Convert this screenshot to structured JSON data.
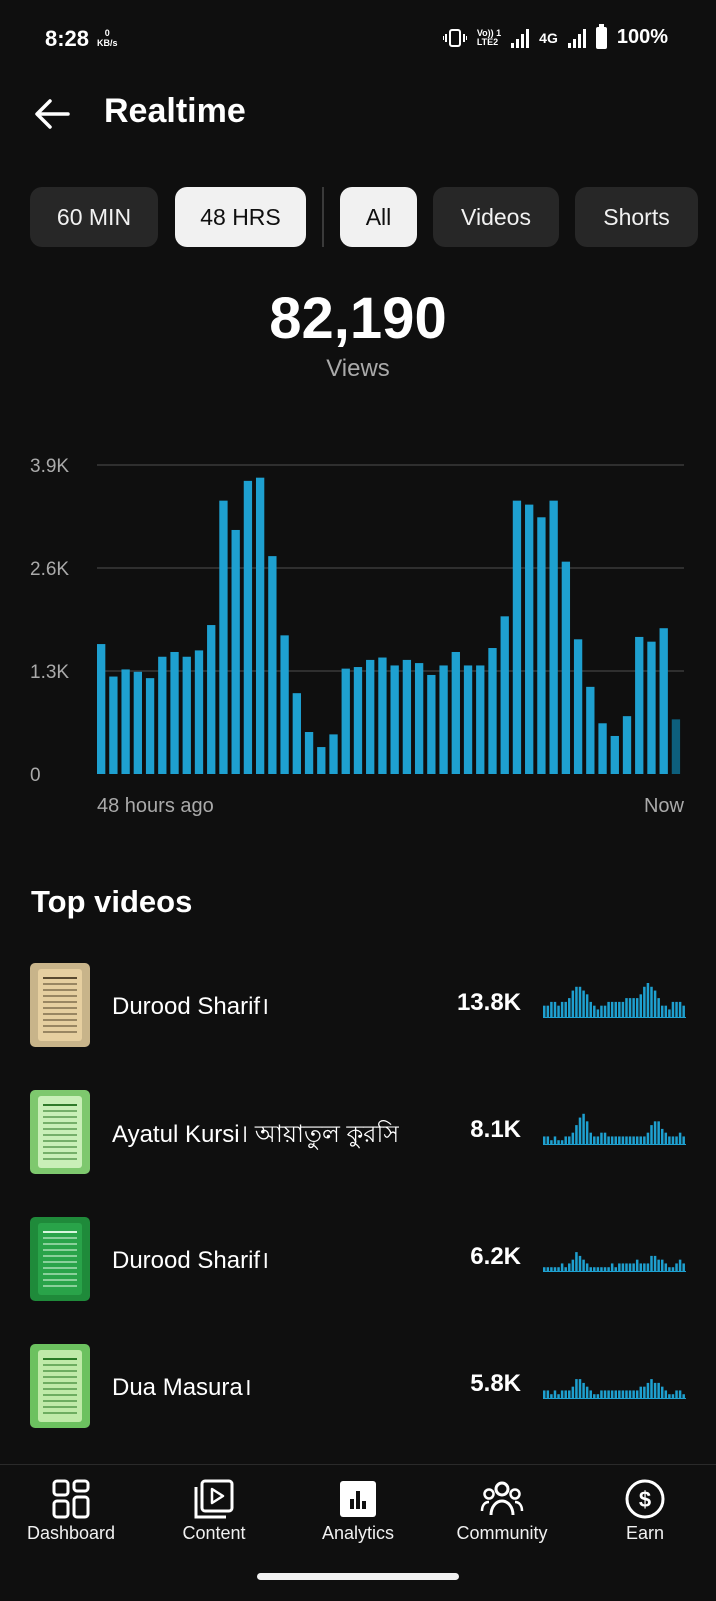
{
  "status": {
    "time": "8:28",
    "speed_value": "0",
    "speed_unit": "KB/s",
    "volte_top": "Vo)) 1",
    "volte_bottom": "LTE2",
    "network": "4G",
    "battery": "100%"
  },
  "header": {
    "title": "Realtime"
  },
  "filters": {
    "time_ranges": [
      {
        "label": "60 MIN",
        "selected": false
      },
      {
        "label": "48 HRS",
        "selected": true
      }
    ],
    "content_types": [
      {
        "label": "All",
        "selected": true
      },
      {
        "label": "Videos",
        "selected": false
      },
      {
        "label": "Shorts",
        "selected": false
      }
    ]
  },
  "summary": {
    "total_views": "82,190",
    "views_label": "Views"
  },
  "chart_data": {
    "type": "bar",
    "title": "",
    "y_ticks": [
      "0",
      "1.3K",
      "2.6K",
      "3.9K"
    ],
    "ylim": [
      0,
      3900
    ],
    "x_start_label": "48 hours ago",
    "x_end_label": "Now",
    "grid": true,
    "bar_color": "#1ea0d0",
    "last_bar_color": "#0d5f7d",
    "values": [
      1640,
      1230,
      1320,
      1290,
      1210,
      1480,
      1540,
      1480,
      1560,
      1880,
      3450,
      3080,
      3700,
      3740,
      2750,
      1750,
      1020,
      530,
      340,
      500,
      1330,
      1350,
      1440,
      1470,
      1370,
      1440,
      1400,
      1250,
      1370,
      1540,
      1370,
      1370,
      1590,
      1990,
      3450,
      3400,
      3240,
      3450,
      2680,
      1700,
      1100,
      640,
      480,
      730,
      1730,
      1670,
      1840,
      690
    ]
  },
  "top_videos": {
    "title": "Top videos",
    "items": [
      {
        "title": "Durood Sharif।",
        "views": "13.8K",
        "thumb_bg": "#c8b48a",
        "thumb_page": "#e6cfa0",
        "thumb_line": "#5a4a30",
        "spark": [
          3,
          3,
          4,
          4,
          3,
          4,
          4,
          5,
          7,
          8,
          8,
          7,
          6,
          4,
          3,
          2,
          3,
          3,
          4,
          4,
          4,
          4,
          4,
          5,
          5,
          5,
          5,
          6,
          8,
          9,
          8,
          7,
          5,
          3,
          3,
          2,
          4,
          4,
          4,
          3
        ]
      },
      {
        "title": "Ayatul Kursi। আয়াতুল কুরসি",
        "views": "8.1K",
        "thumb_bg": "#7ec86e",
        "thumb_page": "#c9efb8",
        "thumb_line": "#2f7a2a",
        "spark": [
          2,
          2,
          1,
          2,
          1,
          1,
          2,
          2,
          3,
          5,
          7,
          8,
          6,
          3,
          2,
          2,
          3,
          3,
          2,
          2,
          2,
          2,
          2,
          2,
          2,
          2,
          2,
          2,
          2,
          3,
          5,
          6,
          6,
          4,
          3,
          2,
          2,
          2,
          3,
          2
        ]
      },
      {
        "title": "Durood Sharif।",
        "views": "6.2K",
        "thumb_bg": "#1f8a3a",
        "thumb_page": "#29a349",
        "thumb_line": "#d8f5dd",
        "spark": [
          1,
          1,
          1,
          1,
          1,
          2,
          1,
          2,
          3,
          5,
          4,
          3,
          2,
          1,
          1,
          1,
          1,
          1,
          1,
          2,
          1,
          2,
          2,
          2,
          2,
          2,
          3,
          2,
          2,
          2,
          4,
          4,
          3,
          3,
          2,
          1,
          1,
          2,
          3,
          2
        ]
      },
      {
        "title": "Dua Masura।",
        "views": "5.8K",
        "thumb_bg": "#6cc15f",
        "thumb_page": "#bfeaa8",
        "thumb_line": "#2a7a25",
        "spark": [
          2,
          2,
          1,
          2,
          1,
          2,
          2,
          2,
          3,
          5,
          5,
          4,
          3,
          2,
          1,
          1,
          2,
          2,
          2,
          2,
          2,
          2,
          2,
          2,
          2,
          2,
          2,
          3,
          3,
          4,
          5,
          4,
          4,
          3,
          2,
          1,
          1,
          2,
          2,
          1
        ]
      }
    ]
  },
  "bottom_nav": [
    {
      "label": "Dashboard",
      "icon": "dashboard-icon"
    },
    {
      "label": "Content",
      "icon": "content-icon"
    },
    {
      "label": "Analytics",
      "icon": "analytics-icon",
      "active": true
    },
    {
      "label": "Community",
      "icon": "community-icon"
    },
    {
      "label": "Earn",
      "icon": "earn-icon"
    }
  ]
}
